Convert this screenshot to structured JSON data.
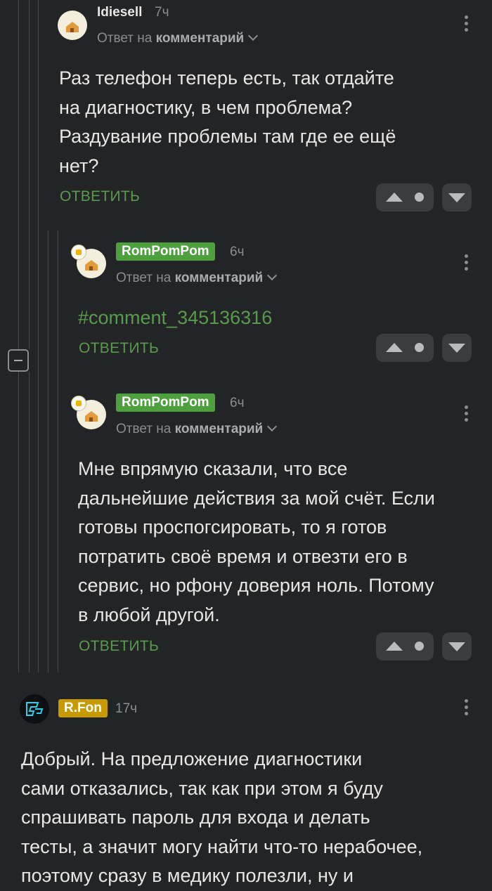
{
  "comments": [
    {
      "username": "Idiesell",
      "time": "7ч",
      "reply_prefix": "Ответ на",
      "reply_target": "комментарий",
      "text_lines": [
        "Раз телефон теперь есть, так отдайте",
        "на диагностику, в чем проблема?",
        "Раздувание проблемы там где ее ещё",
        "нет?"
      ],
      "reply_label": "ОТВЕТИТЬ"
    },
    {
      "username": "RomPomPom",
      "time": "6ч",
      "reply_prefix": "Ответ на",
      "reply_target": "комментарий",
      "link_text": "#comment_345136316",
      "reply_label": "ОТВЕТИТЬ"
    },
    {
      "username": "RomPomPom",
      "time": "6ч",
      "reply_prefix": "Ответ на",
      "reply_target": "комментарий",
      "text_lines": [
        "Мне впрямую сказали, что все",
        "дальнейшие действия за мой счёт. Если",
        "готовы проспогсировать, то я готов",
        "потратить своё время и отвезти его в",
        "сервис, но рфону доверия ноль. Потому",
        "в любой другой."
      ],
      "reply_label": "ОТВЕТИТЬ"
    },
    {
      "username": "R.Fon",
      "time": "17ч",
      "text_lines": [
        "Добрый. На предложение диагностики",
        "сами отказались, так как при этом я буду",
        "спрашивать пароль для входа и делать",
        "тесты, а значит могу найти что-то нерабочее,",
        "поэтому сразу в медику полезли, ну и"
      ]
    }
  ],
  "colors": {
    "background": "#222426",
    "accent_green": "#4e9f3d",
    "reply_green": "#5a9a4e",
    "rfon_badge": "#c79a00"
  },
  "icons": [
    "more-vertical-icon",
    "vote-up-icon",
    "vote-down-icon",
    "collapse-icon",
    "chevron-down-icon"
  ]
}
